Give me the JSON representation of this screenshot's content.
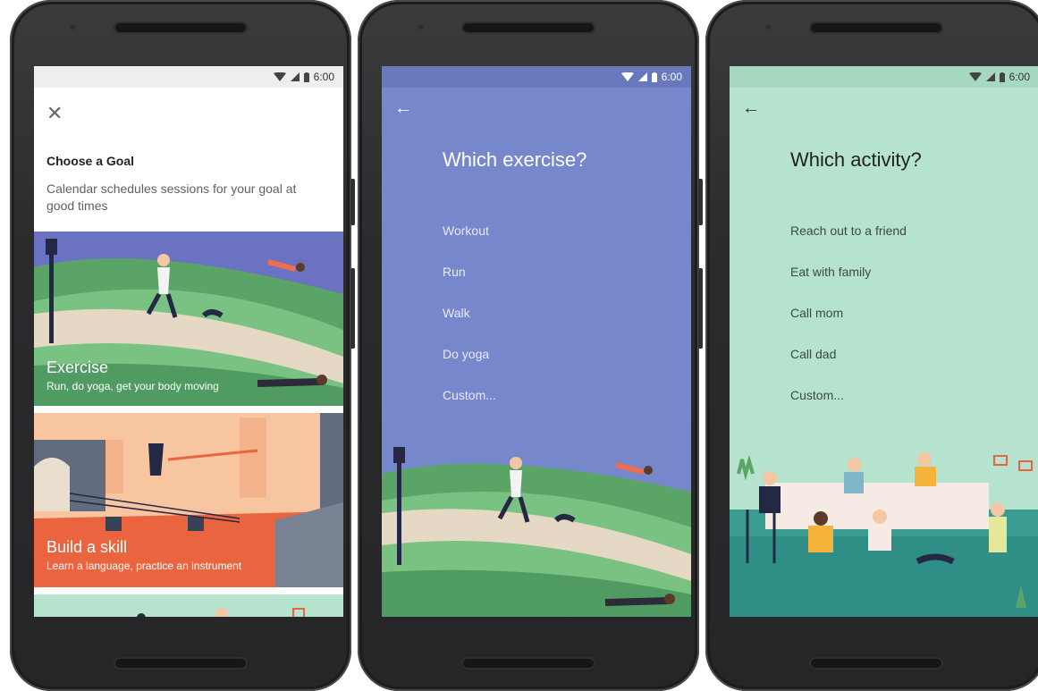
{
  "status_bar": {
    "time": "6:00"
  },
  "screen_goal": {
    "close_icon": "close-icon",
    "title": "Choose a Goal",
    "description": "Calendar schedules sessions for your goal at good times",
    "cards": [
      {
        "title": "Exercise",
        "subtitle": "Run, do yoga, get your body moving",
        "color": "#6b72c2"
      },
      {
        "title": "Build a skill",
        "subtitle": "Learn a language, practice an instrument",
        "color": "#f7c59f"
      }
    ]
  },
  "screen_exercise": {
    "back_icon": "arrow-back-icon",
    "title": "Which exercise?",
    "options": [
      "Workout",
      "Run",
      "Walk",
      "Do yoga",
      "Custom..."
    ],
    "background": "#7687cb"
  },
  "screen_activity": {
    "back_icon": "arrow-back-icon",
    "title": "Which activity?",
    "options": [
      "Reach out to a friend",
      "Eat with family",
      "Call mom",
      "Call dad",
      "Custom..."
    ],
    "background": "#b6e3cd"
  }
}
